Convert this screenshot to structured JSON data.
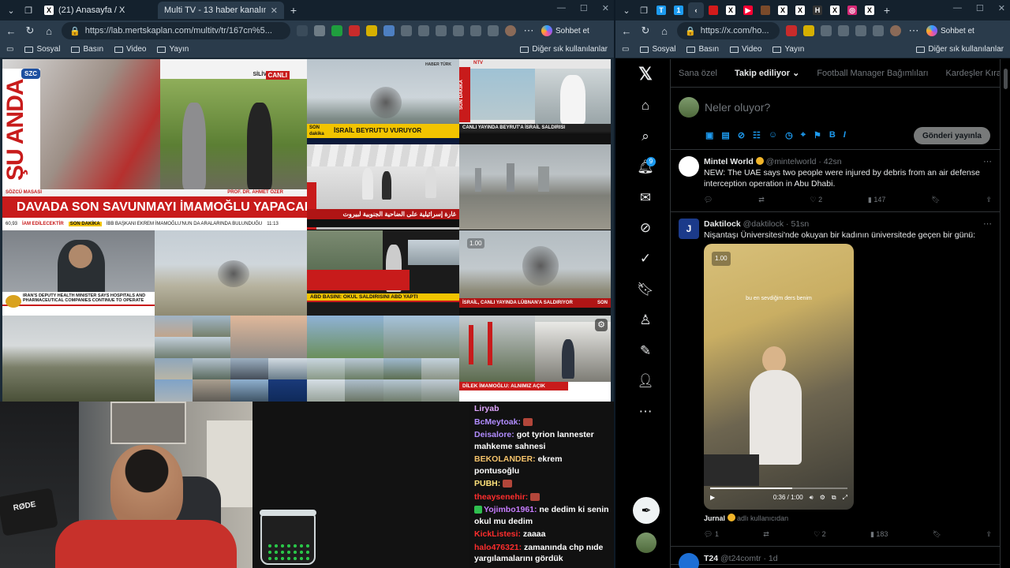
{
  "left_browser": {
    "tabs": [
      {
        "label": "(21) Anasayfa / X",
        "favicon": "X",
        "active": false
      },
      {
        "label": "Multi TV - 13 haber kanalını aynı a",
        "favicon": "",
        "active": true
      }
    ],
    "url": "https://lab.mertskaplan.com/multitv/tr/167cn%5...",
    "copilot_label": "Sohbet et",
    "bookmarks": [
      "Sosyal",
      "Basın",
      "Video",
      "Yayın"
    ],
    "other_bookmarks": "Diğer sık kullanılanlar"
  },
  "tv": {
    "szc": {
      "logo": "SZC",
      "live": "CANLI",
      "location": "SİLİVRİ",
      "side_text": "ŞU ANDA",
      "desk": "SÖZCÜ MASASI",
      "guest": "PROF. DR. AHMET ÖZER",
      "headline": "DAVADA SON SAVUNMAYI İMAMOĞLU YAPACAK",
      "ticker_left": "60,93",
      "ticker_right": "11:13",
      "ticker_mid": "İAM EDİLECEKTİR",
      "ticker_tag": "SON DAKİKA",
      "ticker_text": "İBB BAŞKANI EKREM İMAMOĞLU'NUN DA ARALARINDA BULUNDUĞU"
    },
    "haberturk": {
      "channel": "HABER TÜRK",
      "tag": "SON dakika",
      "headline": "İSRAİL BEYRUT'U VURUYOR"
    },
    "channel_top_right": {
      "tag": "SON DAKİKA",
      "headline": "CANLI YAYINDA BEYRUT'A İSRAİL SALDIRISI",
      "channel": "NTV"
    },
    "aljazeera": {
      "headline": "IRAN'S DEPUTY HEALTH MINISTER SAYS HOSPITALS AND PHARMACEUTICAL COMPANIES CONTINUE TO OPERATE"
    },
    "arabic": {
      "headline": "غارة إسرائيلية على الضاحية الجنوبية لبيروت"
    },
    "cnn": {
      "tag": "SON DAKİKA",
      "headline": "ABD BASINI: OKUL SALDIRISINI ABD YAPTI"
    },
    "israel_live": {
      "badge": "1.00",
      "headline": "İSRAİL, CANLI YAYINDA LÜBNAN'A SALDIRIYOR",
      "tag": "SON"
    },
    "dilek": {
      "headline": "DİLEK İMAMOĞLU: ALNIMIZ AÇIK"
    }
  },
  "chat": [
    {
      "user": "Liryab",
      "text": "",
      "color": "#e0a6ff",
      "emote": false
    },
    {
      "user": "BcMeytoak:",
      "text": "",
      "color": "#b18cff",
      "emote": true
    },
    {
      "user": "Deisalore:",
      "text": "got tyrion lannester mahkeme sahnesi",
      "color": "#b18cff",
      "emote": false
    },
    {
      "user": "BEKOLANDER:",
      "text": "ekrem pontusoğlu",
      "color": "#f5c36a",
      "emote": false
    },
    {
      "user": "PUBH:",
      "text": "",
      "color": "#ffe27a",
      "emote": true
    },
    {
      "user": "theaysenehir:",
      "text": "",
      "color": "#ff2d2d",
      "emote": true
    },
    {
      "user": "Yojimbo1961:",
      "text": "ne dedim ki senin okul mu dedim",
      "color": "#c77dff",
      "emote": false,
      "badge": true
    },
    {
      "user": "KickListesi:",
      "text": "zaaaa",
      "color": "#ff2d2d",
      "emote": false
    },
    {
      "user": "halo476321:",
      "text": "zamanında chp nıde yargılamalarını gördük",
      "color": "#ff2d2d",
      "emote": false
    }
  ],
  "webcam": {
    "mic_brand": "RØDE"
  },
  "right_browser": {
    "url": "https://x.com/ho...",
    "copilot_label": "Sohbet et",
    "bookmarks": [
      "Sosyal",
      "Basın",
      "Video",
      "Yayın"
    ],
    "other_bookmarks": "Diğer sık kullanılanlar"
  },
  "x": {
    "notification_count": "9",
    "tabs": [
      "Sana özel",
      "Takip ediliyor",
      "Football Manager Bağımlıları",
      "Kardeşler Kıra"
    ],
    "compose_placeholder": "Neler oluyor?",
    "post_button": "Gönderi yayınla",
    "tweets": [
      {
        "name": "Mintel World",
        "handle": "@mintelworld",
        "time": "42sn",
        "text": "NEW: The UAE says two people were injured by debris from an air defense interception operation in Abu Dhabi.",
        "replies": "",
        "retweets": "",
        "likes": "2",
        "views": "147"
      },
      {
        "name": "Daktilock",
        "handle": "@daktilock",
        "time": "51sn",
        "text": "Nişantaşı Üniversitesi'nde okuyan bir kadının üniversitede geçen bir günü:",
        "media_caption": "bu en sevdiğim ders benim",
        "media_badge": "1.00",
        "media_time": "0:36 / 1:00",
        "media_progress": 0.6,
        "attribution_name": "Jurnal",
        "attribution_text": "adlı kullanıcıdan",
        "replies": "1",
        "retweets": "",
        "likes": "2",
        "views": "183"
      },
      {
        "name": "T24",
        "handle": "@t24comtr",
        "time": "1d"
      }
    ]
  },
  "colors": {
    "x_blue": "#1d9bf0",
    "breaking_red": "#c81b1b",
    "gold_verified": "#f0b429"
  }
}
